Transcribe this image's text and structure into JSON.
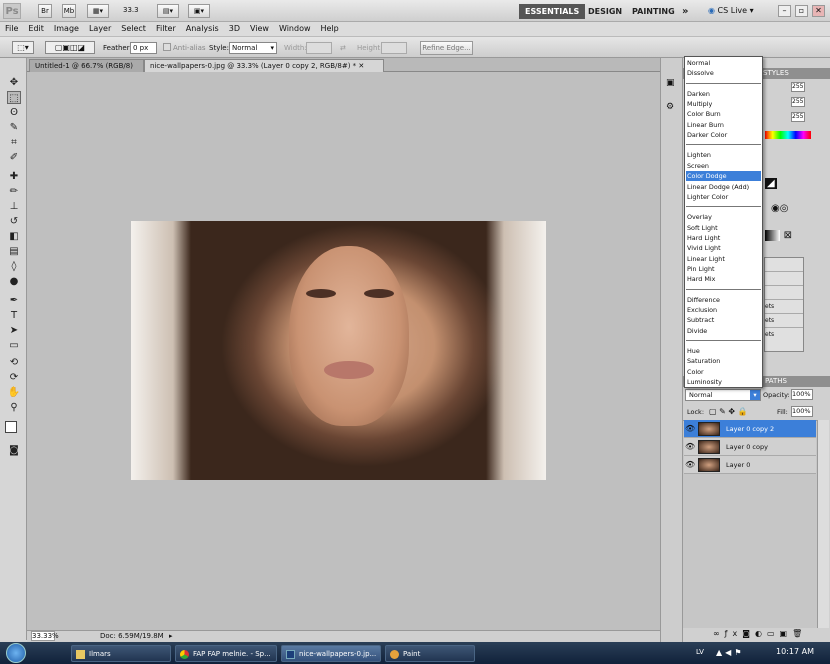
{
  "app": {
    "logo": "Ps",
    "bridge_label": "Br",
    "minibridge_label": "Mb",
    "zoom": "33.3",
    "workspaces": [
      "ESSENTIALS",
      "DESIGN",
      "PAINTING"
    ],
    "more": "»",
    "cslive": "CS Live",
    "window_controls": [
      "–",
      "▫",
      "✕"
    ]
  },
  "menubar": [
    "File",
    "Edit",
    "Image",
    "Layer",
    "Select",
    "Filter",
    "Analysis",
    "3D",
    "View",
    "Window",
    "Help"
  ],
  "options": {
    "feather_label": "Feather:",
    "feather_value": "0 px",
    "antialias_label": "Anti-alias",
    "style_label": "Style:",
    "style_value": "Normal",
    "width_label": "Width:",
    "height_label": "Height:",
    "refine_label": "Refine Edge..."
  },
  "tabs": [
    {
      "label": "Untitled-1 @ 66.7% (RGB/8)"
    },
    {
      "label": "nice-wallpapers-0.jpg @ 33.3% (Layer 0 copy 2, RGB/8#) *"
    }
  ],
  "status": {
    "zoom": "33.33%",
    "doc": "Doc: 6.59M/19.8M"
  },
  "panels": {
    "styles_tab": "STYLES",
    "paths_tab": "PATHS",
    "color_values": [
      "255",
      "255",
      "255"
    ],
    "style_rows": [
      "ets",
      "ets",
      "ets"
    ],
    "lock_label": "Lock:",
    "opacity_label": "Opacity:",
    "opacity_value": "100%",
    "fill_label": "Fill:",
    "fill_value": "100%",
    "blend_value": "Normal"
  },
  "blend_modes": [
    [
      "Normal",
      "Dissolve"
    ],
    [
      "Darken",
      "Multiply",
      "Color Burn",
      "Linear Burn",
      "Darker Color"
    ],
    [
      "Lighten",
      "Screen",
      "Color Dodge",
      "Linear Dodge (Add)",
      "Lighter Color"
    ],
    [
      "Overlay",
      "Soft Light",
      "Hard Light",
      "Vivid Light",
      "Linear Light",
      "Pin Light",
      "Hard Mix"
    ],
    [
      "Difference",
      "Exclusion",
      "Subtract",
      "Divide"
    ],
    [
      "Hue",
      "Saturation",
      "Color",
      "Luminosity"
    ]
  ],
  "blend_selected": "Color Dodge",
  "layers": [
    {
      "name": "Layer 0 copy 2",
      "active": true
    },
    {
      "name": "Layer 0 copy",
      "active": false
    },
    {
      "name": "Layer 0",
      "active": false
    }
  ],
  "taskbar": {
    "items": [
      {
        "label": "Ilmars",
        "icon": "folder-icon"
      },
      {
        "label": "FAP FAP melnie. - Sp...",
        "icon": "chrome-icon"
      },
      {
        "label": "nice-wallpapers-0.jp...",
        "icon": "photoshop-icon"
      },
      {
        "label": "Paint",
        "icon": "paint-icon"
      }
    ],
    "lang": "LV",
    "clock": "10:17 AM"
  },
  "colors": {
    "accent": "#3c7fd9",
    "workspace_active": "#555555"
  }
}
